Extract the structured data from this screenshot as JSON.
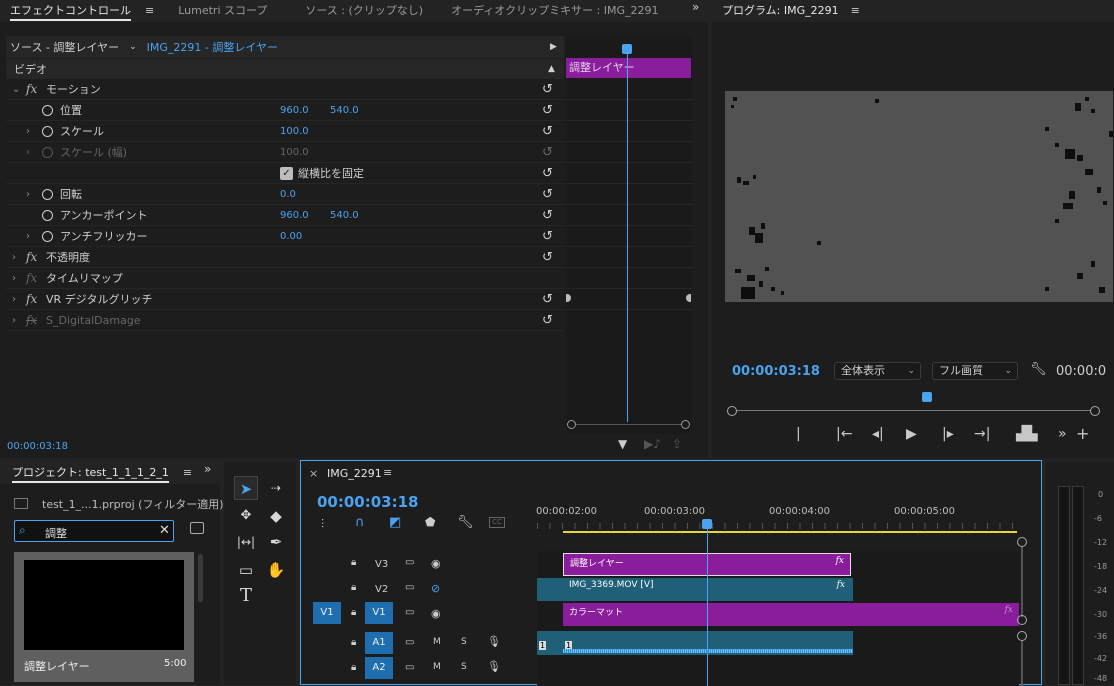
{
  "effect_controls": {
    "tabs": [
      {
        "label": "エフェクトコントロール"
      },
      {
        "label": "Lumetri スコープ"
      },
      {
        "label": "ソース : (クリップなし)"
      },
      {
        "label": "オーディオクリップミキサー : IMG_2291"
      }
    ],
    "source_label": "ソース - 調整レイヤー",
    "sequence_label": "IMG_2291 - 調整レイヤー",
    "section": "ビデオ",
    "rows": [
      {
        "label": "モーション"
      },
      {
        "label": "位置",
        "v1": "960.0",
        "v2": "540.0"
      },
      {
        "label": "スケール",
        "v1": "100.0"
      },
      {
        "label": "スケール (幅)",
        "v1": "100.0"
      },
      {
        "label": "縦横比を固定"
      },
      {
        "label": "回転",
        "v1": "0.0"
      },
      {
        "label": "アンカーポイント",
        "v1": "960.0",
        "v2": "540.0"
      },
      {
        "label": "アンチフリッカー",
        "v1": "0.00"
      },
      {
        "label": "不透明度"
      },
      {
        "label": "タイムリマップ"
      },
      {
        "label": "VR デジタルグリッチ"
      },
      {
        "label": "S_DigitalDamage"
      }
    ],
    "clip_label": "調整レイヤー",
    "timecode": "00:00:03:18"
  },
  "program": {
    "title": "プログラム: IMG_2291",
    "timecode": "00:00:03:18",
    "zoom": "全体表示",
    "quality": "フル画質",
    "duration_partial": "00:00:0"
  },
  "project": {
    "title": "プロジェクト: test_1_1_1_2_1",
    "file": "test_1_...1.prproj (フィルター適用)",
    "search_value": "調整",
    "item_name": "調整レイヤー",
    "item_duration": "5:00"
  },
  "timeline": {
    "title": "IMG_2291",
    "timecode": "00:00:03:18",
    "ruler": [
      "00:00:02:00",
      "00:00:03:00",
      "00:00:04:00",
      "00:00:05:00"
    ],
    "tracks": [
      {
        "name": "V3"
      },
      {
        "name": "V2"
      },
      {
        "name": "V1",
        "source": "V1"
      },
      {
        "name": "A1",
        "mute": "M",
        "solo": "S"
      },
      {
        "name": "A2",
        "mute": "M",
        "solo": "S"
      }
    ],
    "clips": {
      "v3": "調整レイヤー",
      "v2": "IMG_3369.MOV [V]",
      "v1": "カラーマット",
      "fx": "fx",
      "a1_marker": "1"
    }
  },
  "meter": {
    "labels": [
      "0",
      "-6",
      "-12",
      "-18",
      "-24",
      "-30",
      "-36",
      "-42",
      "-48"
    ]
  },
  "colors": {
    "accent_blue": "#4aa3f0",
    "clip_purple": "#8a1d9c",
    "clip_teal": "#1f5f78",
    "track_blue": "#1f6fb0"
  }
}
